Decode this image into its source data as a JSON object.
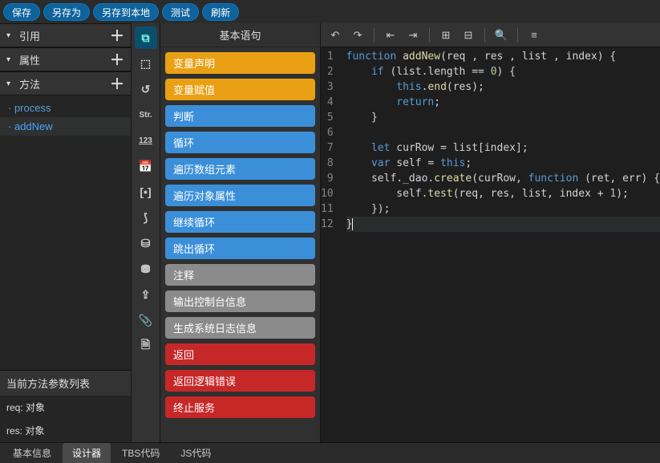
{
  "topbar": {
    "save": "保存",
    "saveAs": "另存为",
    "saveLocal": "另存到本地",
    "test": "测试",
    "refresh": "刷新"
  },
  "left": {
    "ref": {
      "title": "引用"
    },
    "attr": {
      "title": "属性"
    },
    "method": {
      "title": "方法",
      "items": [
        {
          "label": "· process",
          "active": false
        },
        {
          "label": "· addNew",
          "active": true
        }
      ]
    },
    "paramsTitle": "当前方法参数列表",
    "params": [
      {
        "label": "req: 对象"
      },
      {
        "label": "res: 对象"
      }
    ]
  },
  "rail": {
    "items": [
      {
        "name": "link-icon",
        "glyph": "⧉",
        "sel": true
      },
      {
        "name": "shield-icon",
        "glyph": "⬚"
      },
      {
        "name": "cycle-icon",
        "glyph": "↺"
      },
      {
        "name": "str-icon",
        "glyph": "Str.",
        "text": true
      },
      {
        "name": "num-icon",
        "glyph": "123",
        "text": true,
        "und": true
      },
      {
        "name": "date-icon",
        "glyph": "📅"
      },
      {
        "name": "array-icon",
        "glyph": "[•]"
      },
      {
        "name": "db-icon",
        "glyph": "⟆"
      },
      {
        "name": "storage-icon",
        "glyph": "⛁"
      },
      {
        "name": "disk-icon",
        "glyph": "⛃"
      },
      {
        "name": "export-icon",
        "glyph": "⇪"
      },
      {
        "name": "attach-icon",
        "glyph": "📎"
      },
      {
        "name": "doc-icon",
        "glyph": "🗎"
      }
    ]
  },
  "palette": {
    "title": "基本语句",
    "blocks": [
      {
        "label": "变量声明",
        "cls": "c-orange"
      },
      {
        "label": "变量赋值",
        "cls": "c-orange"
      },
      {
        "label": "判断",
        "cls": "c-blue"
      },
      {
        "label": "循环",
        "cls": "c-blue"
      },
      {
        "label": "遍历数组元素",
        "cls": "c-blue"
      },
      {
        "label": "遍历对象属性",
        "cls": "c-blue"
      },
      {
        "label": "继续循环",
        "cls": "c-blue"
      },
      {
        "label": "跳出循环",
        "cls": "c-blue"
      },
      {
        "label": "注释",
        "cls": "c-gray"
      },
      {
        "label": "输出控制台信息",
        "cls": "c-gray"
      },
      {
        "label": "生成系统日志信息",
        "cls": "c-gray"
      },
      {
        "label": "返回",
        "cls": "c-red"
      },
      {
        "label": "返回逻辑错误",
        "cls": "c-red"
      },
      {
        "label": "终止服务",
        "cls": "c-red"
      }
    ]
  },
  "editor": {
    "lines": 12,
    "code": [
      "function addNew(req , res , list , index) {",
      "    if (list.length == 0) {",
      "        this.end(res);",
      "        return;",
      "    }",
      "",
      "    let curRow = list[index];",
      "    var self = this;",
      "    self._dao.create(curRow, function (ret, err) {",
      "        self.test(req, res, list, index + 1);",
      "    });",
      "}"
    ]
  },
  "bottomTabs": {
    "items": [
      {
        "label": "基本信息",
        "active": false
      },
      {
        "label": "设计器",
        "active": true
      },
      {
        "label": "TBS代码",
        "active": false
      },
      {
        "label": "JS代码",
        "active": false
      }
    ]
  }
}
